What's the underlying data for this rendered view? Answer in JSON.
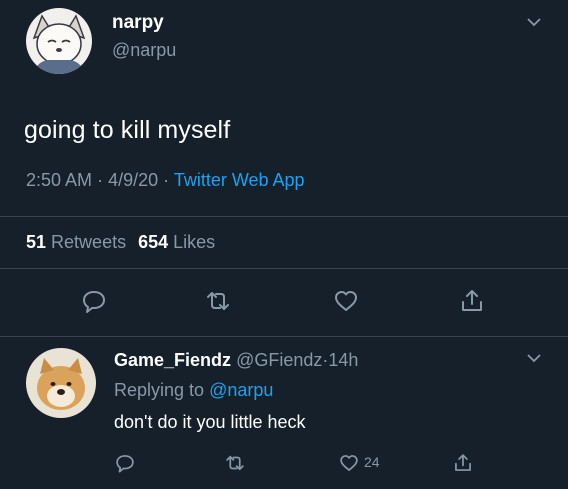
{
  "tweet": {
    "display_name": "narpy",
    "handle": "@narpu",
    "text": "going to kill myself",
    "time": "2:50 AM",
    "date": "4/9/20",
    "source": "Twitter Web App",
    "retweet_count": "51",
    "retweet_label": "Retweets",
    "like_count": "654",
    "like_label": "Likes",
    "sep": "·"
  },
  "reply": {
    "display_name": "Game_Fiendz",
    "handle": "@GFiendz",
    "age": "14h",
    "sep": "·",
    "replying_to_label": "Replying to",
    "replying_to_handle": "@narpu",
    "text": "don't do it you little heck",
    "like_count": "24"
  },
  "icons": {
    "reply": "reply-icon",
    "retweet": "retweet-icon",
    "like": "heart-icon",
    "share": "share-icon",
    "menu": "chevron-down-icon"
  },
  "colors": {
    "background": "#15202b",
    "secondary_text": "#8899a6",
    "link": "#1da1f2",
    "divider": "#38444d"
  }
}
